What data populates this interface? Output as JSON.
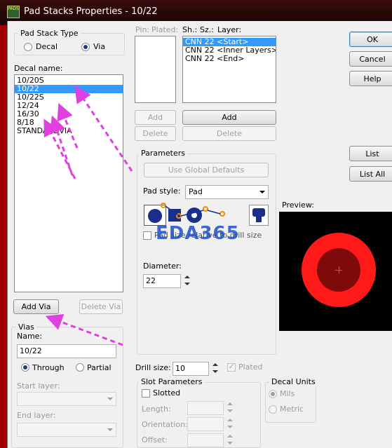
{
  "window": {
    "title": "Pad Stacks Properties - 10/22",
    "app_icon_text": "PADS"
  },
  "pad_stack_type": {
    "legend": "Pad Stack Type",
    "options": [
      "Decal",
      "Via"
    ],
    "selected": "Via"
  },
  "decal_name": {
    "label": "Decal name:",
    "items": [
      "10/20S",
      "10/22",
      "10/22S",
      "12/24",
      "16/30",
      "8/18",
      "STANDARDVIA"
    ],
    "selected": "10/22"
  },
  "add_via_button": "Add Via",
  "delete_via_button": "Delete Via",
  "vias": {
    "legend": "Vias",
    "name_label": "Name:",
    "name_value": "10/22",
    "through_label": "Through",
    "partial_label": "Partial",
    "selected": "Through",
    "start_layer_label": "Start layer:",
    "end_layer_label": "End layer:"
  },
  "pins": {
    "pin_header": "Pin:",
    "plated_header": "Plated:",
    "add_label": "Add",
    "delete_label": "Delete"
  },
  "layers": {
    "sh_header": "Sh.:",
    "sz_header": "Sz.:",
    "layer_header": "Layer:",
    "items": [
      "CNN 22 <Start>",
      "CNN 22 <Inner Layers>",
      "CNN 22 <End>"
    ],
    "selected": "CNN 22 <Start>",
    "add_label": "Add",
    "delete_label": "Delete"
  },
  "parameters": {
    "legend": "Parameters",
    "use_global_defaults": "Use Global Defaults",
    "pad_style_label": "Pad style:",
    "pad_style_value": "Pad",
    "pad_size_checkbox": "Pad size relative to drill size",
    "diameter_label": "Diameter:",
    "diameter_value": "22"
  },
  "watermark": "EDA365",
  "drill": {
    "label": "Drill size:",
    "value": "10",
    "plated_label": "Plated",
    "plated_checked": true
  },
  "slot": {
    "legend": "Slot Parameters",
    "slotted_label": "Slotted",
    "length_label": "Length:",
    "orientation_label": "Orientation:",
    "offset_label": "Offset:"
  },
  "decal_units": {
    "legend": "Decal Units",
    "options": [
      "Mils",
      "Metric"
    ],
    "selected": "Mils"
  },
  "buttons": {
    "ok": "OK",
    "cancel": "Cancel",
    "help": "Help",
    "list": "List",
    "list_all": "List All"
  },
  "preview": {
    "label": "Preview:",
    "outer_color": "#ff1a1a",
    "inner_color": "#7f0a0a",
    "background": "#000000"
  },
  "colors": {
    "selection": "#3399ff",
    "annotation_arrow": "#e040e0",
    "pad_icon_blue": "#1a2f8a"
  }
}
